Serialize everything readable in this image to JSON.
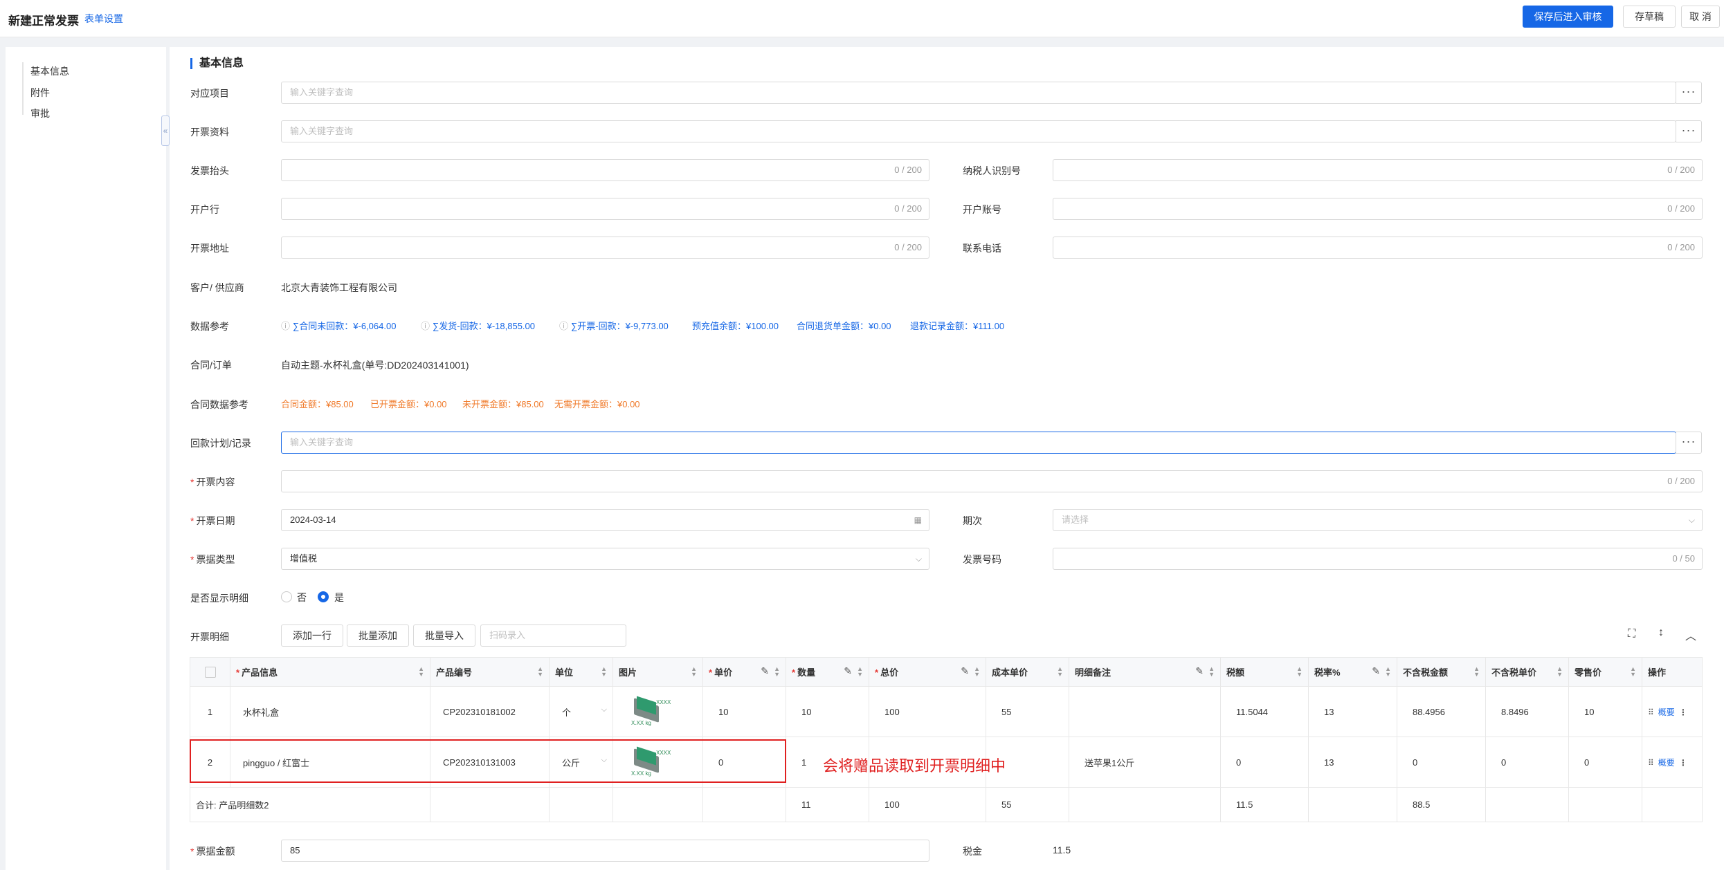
{
  "header": {
    "title": "新建正常发票",
    "settings_link": "表单设置",
    "save_submit": "保存后进入审核",
    "save_draft": "存草稿",
    "cancel": "取 消"
  },
  "sidebar": {
    "items": [
      {
        "label": "基本信息"
      },
      {
        "label": "附件"
      },
      {
        "label": "审批"
      }
    ],
    "collapse_icon": "«"
  },
  "section": {
    "title": "基本信息"
  },
  "form": {
    "project": {
      "label": "对应项目",
      "placeholder": "输入关键字查询"
    },
    "invoice_info": {
      "label": "开票资料",
      "placeholder": "输入关键字查询"
    },
    "invoice_header": {
      "label": "发票抬头",
      "counter": "0 / 200"
    },
    "taxpayer_id": {
      "label": "纳税人识别号",
      "counter": "0 / 200"
    },
    "bank": {
      "label": "开户行",
      "counter": "0 / 200"
    },
    "bank_account": {
      "label": "开户账号",
      "counter": "0 / 200"
    },
    "address": {
      "label": "开票地址",
      "counter": "0 / 200"
    },
    "phone": {
      "label": "联系电话",
      "counter": "0 / 200"
    },
    "customer": {
      "label": "客户/ 供应商",
      "value": "北京大青装饰工程有限公司"
    },
    "data_ref": {
      "label": "数据参考",
      "items": [
        "∑合同未回款：¥-6,064.00",
        "∑发货-回款：¥-18,855.00",
        "∑开票-回款：¥-9,773.00",
        "预充值余额：¥100.00",
        "合同退货单金额：¥0.00",
        "退款记录金额：¥111.00"
      ]
    },
    "contract": {
      "label": "合同/订单",
      "value": "自动主题-水杯礼盒(单号:DD202403141001)"
    },
    "contract_ref": {
      "label": "合同数据参考",
      "items": [
        "合同金额：¥85.00",
        "已开票金额：¥0.00",
        "未开票金额：¥85.00",
        "无需开票金额：¥0.00"
      ]
    },
    "payment_plan": {
      "label": "回款计划/记录",
      "placeholder": "输入关键字查询"
    },
    "content": {
      "label": "开票内容",
      "counter": "0 / 200"
    },
    "date": {
      "label": "开票日期",
      "value": "2024-03-14"
    },
    "period": {
      "label": "期次",
      "placeholder": "请选择"
    },
    "invoice_type": {
      "label": "票据类型",
      "value": "增值税"
    },
    "invoice_no": {
      "label": "发票号码",
      "counter": "0 / 50"
    },
    "show_detail": {
      "label": "是否显示明细",
      "options": [
        "否",
        "是"
      ],
      "selected": "是"
    },
    "detail": {
      "label": "开票明细",
      "add_row": "添加一行",
      "batch_add": "批量添加",
      "batch_import": "批量导入",
      "scan_placeholder": "扫码录入"
    },
    "amount": {
      "label": "票据金额",
      "value": "85"
    },
    "tax": {
      "label": "税金",
      "value": "11.5"
    }
  },
  "table": {
    "columns": [
      "产品信息",
      "产品编号",
      "单位",
      "图片",
      "单价",
      "数量",
      "总价",
      "成本单价",
      "明细备注",
      "税额",
      "税率%",
      "不含税金额",
      "不含税单价",
      "零售价",
      "操作"
    ],
    "rows": [
      {
        "idx": "1",
        "product": "水杯礼盒",
        "code": "CP202310181002",
        "unit": "个",
        "price": "10",
        "qty": "10",
        "total": "100",
        "cost": "55",
        "note": "",
        "tax": "11.5044",
        "rate": "13",
        "net": "88.4956",
        "net_price": "8.8496",
        "retail": "10"
      },
      {
        "idx": "2",
        "product": "pingguo / 红富士",
        "code": "CP202310131003",
        "unit": "公斤",
        "price": "0",
        "qty": "1",
        "total": "",
        "cost": "",
        "note": "送苹果1公斤",
        "tax": "0",
        "rate": "13",
        "net": "0",
        "net_price": "0",
        "retail": "0"
      }
    ],
    "summary": {
      "label": "合计:  产品明细数2",
      "qty": "11",
      "total": "100",
      "cost": "55",
      "tax": "11.5",
      "net": "88.5"
    },
    "op_label": "概要",
    "thumb_text_1": "XXXX",
    "thumb_text_2": "X.XX kg"
  },
  "annotation": "会将赠品读取到开票明细中"
}
